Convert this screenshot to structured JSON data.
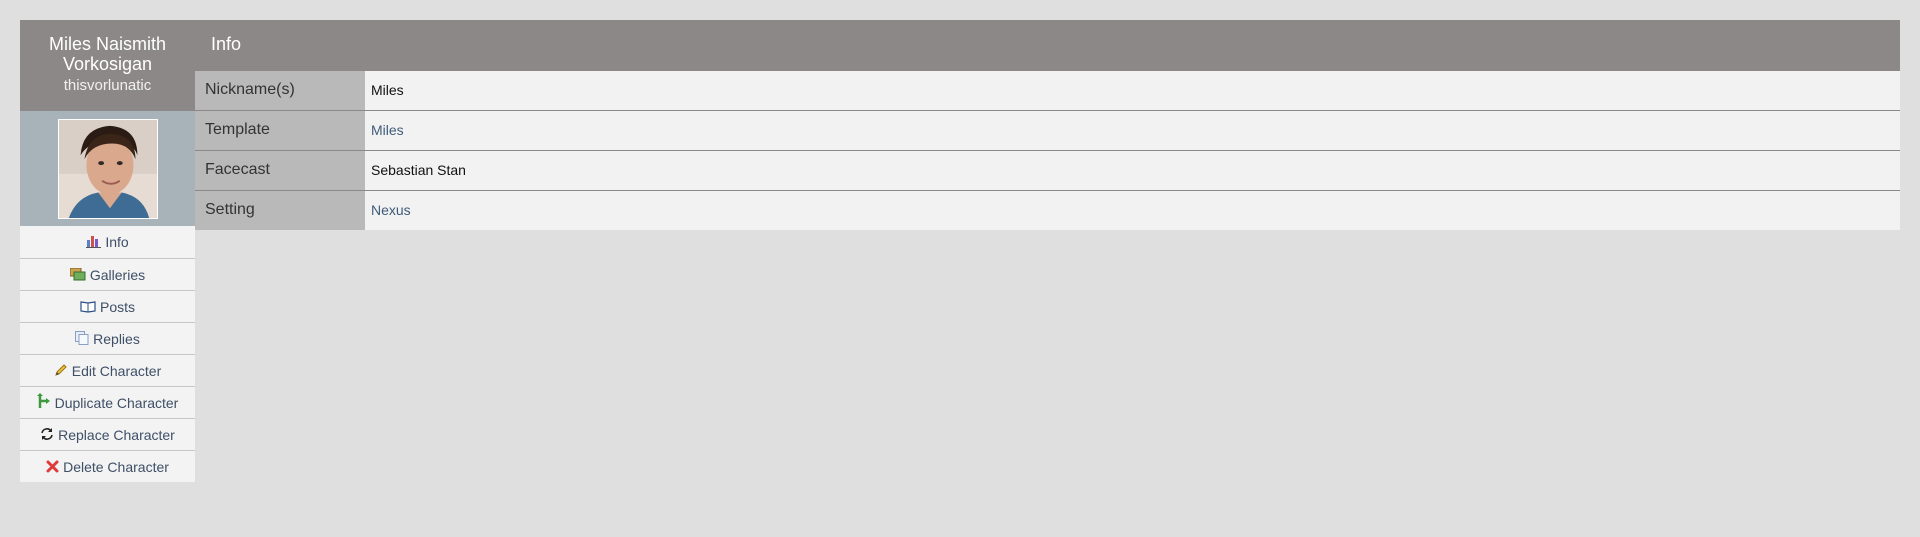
{
  "character": {
    "name": "Miles Naismith Vorkosigan",
    "user": "thisvorlunatic"
  },
  "menu": [
    {
      "label": "Info",
      "icon": "bar-chart-icon"
    },
    {
      "label": "Galleries",
      "icon": "galleries-icon"
    },
    {
      "label": "Posts",
      "icon": "book-icon"
    },
    {
      "label": "Replies",
      "icon": "pages-icon"
    },
    {
      "label": "Edit Character",
      "icon": "pencil-icon"
    },
    {
      "label": "Duplicate Character",
      "icon": "duplicate-icon"
    },
    {
      "label": "Replace Character",
      "icon": "refresh-icon"
    },
    {
      "label": "Delete Character",
      "icon": "delete-x-icon"
    }
  ],
  "main": {
    "title": "Info",
    "rows": [
      {
        "label": "Nickname(s)",
        "value": "Miles",
        "link": false
      },
      {
        "label": "Template",
        "value": "Miles",
        "link": true
      },
      {
        "label": "Facecast",
        "value": "Sebastian Stan",
        "link": false
      },
      {
        "label": "Setting",
        "value": "Nexus",
        "link": true
      }
    ]
  },
  "colors": {
    "header": "#8c8888",
    "label_bg": "#b9b9b9",
    "link": "#3f5b7a",
    "page_bg": "#dfdfdf"
  }
}
